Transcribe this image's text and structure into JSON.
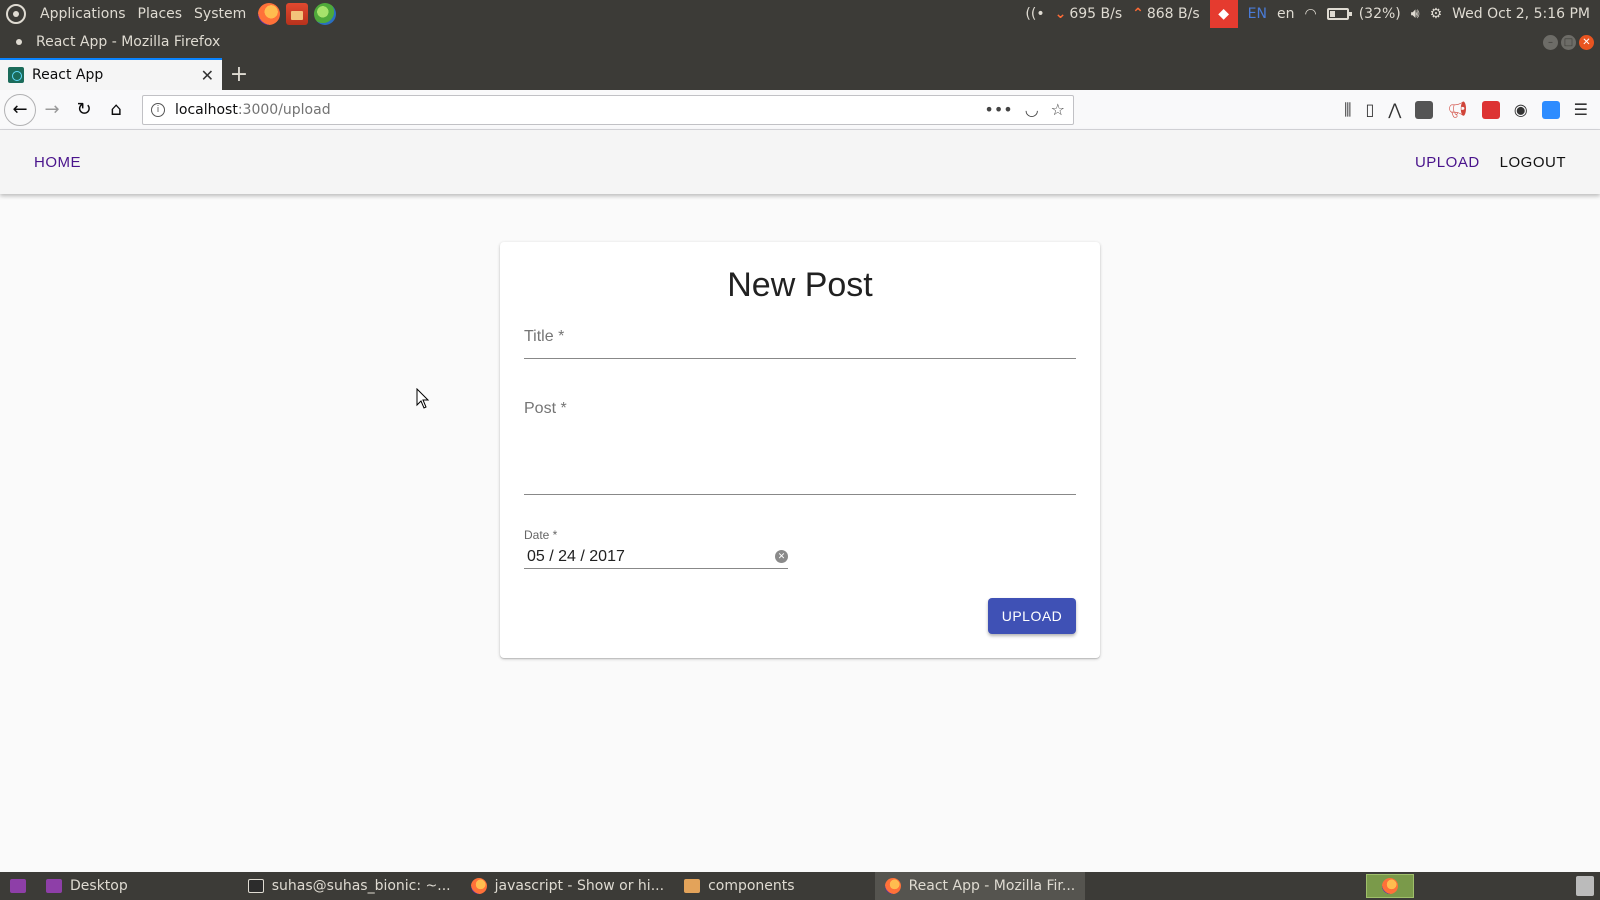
{
  "top_panel": {
    "menus": [
      "Applications",
      "Places",
      "System"
    ],
    "net_down": "695 B/s",
    "net_up": "868 B/s",
    "lang_badge": "EN",
    "lang": "en",
    "battery_pct": "(32%)",
    "battery_level": 0.32,
    "datetime": "Wed Oct 2, 5:16 PM"
  },
  "window": {
    "title": "React App - Mozilla Firefox"
  },
  "tabs": [
    {
      "label": "React App"
    }
  ],
  "urlbar": {
    "host": "localhost",
    "path": ":3000/upload"
  },
  "appbar": {
    "home": "HOME",
    "upload": "UPLOAD",
    "logout": "LOGOUT"
  },
  "form": {
    "title": "New Post",
    "title_label": "Title *",
    "post_label": "Post *",
    "date_label": "Date *",
    "date_value": "05 / 24 / 2017",
    "submit": "UPLOAD"
  },
  "taskbar": {
    "items": [
      "Desktop",
      "suhas@suhas_bionic: ~...",
      "javascript - Show or hi...",
      "components",
      "React App - Mozilla Fir..."
    ]
  },
  "colors": {
    "accent_purple": "#4a148c",
    "primary_button": "#3f51b5",
    "panel_bg": "#3c3b37"
  }
}
